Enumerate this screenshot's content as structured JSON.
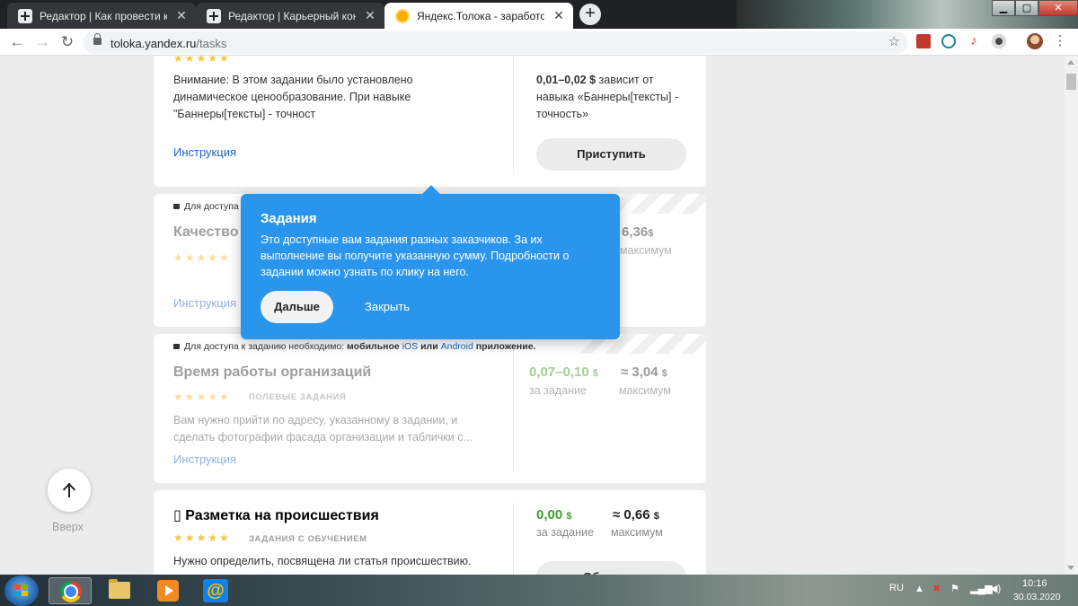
{
  "browser": {
    "tabs": [
      {
        "title": "Редактор | Как провести каранти",
        "close": "✕",
        "active": false
      },
      {
        "title": "Редактор | Карьерный консульт",
        "close": "✕",
        "active": false
      },
      {
        "title": "Яндекс.Толока - заработок в ин",
        "close": "✕",
        "active": true
      }
    ],
    "new_tab": "+",
    "window_controls": {
      "minimize": "▁",
      "maximize": "▢",
      "close": "✕"
    },
    "nav": {
      "back": "←",
      "forward": "→",
      "reload": "↻"
    },
    "url_host": "toloka.yandex.ru",
    "url_path": "/tasks",
    "bookmark_star": "☆"
  },
  "tasks": [
    {
      "stars": "★★★★★",
      "description": "Внимание: В этом задании было установлено динамическое ценообразование. При навыке \"Баннеры[тексты] - точност",
      "instruction": "Инструкция",
      "price_bold": "0,01–0,02 $",
      "price_note": " зависит от навыка «Баннеры[тексты] - точность»",
      "action": "Приступить"
    },
    {
      "access_prefix": "Для доступа",
      "title": "Качество т",
      "stars": "★★★★★",
      "instruction": "Инструкция",
      "max_value": "6,36",
      "currency": "$",
      "max_label": "максимум"
    },
    {
      "access_prefix": "Для доступа к заданию необходимо: ",
      "access_bold1": "мобильное ",
      "access_ios": "iOS",
      "access_or": " или ",
      "access_android": "Android",
      "access_bold2": " приложение.",
      "title": "Время работы организаций",
      "stars": "★★★★★",
      "tag": "ПОЛЕВЫЕ ЗАДАНИЯ",
      "description": "Вам нужно прийти по адресу, указанному в задании, и сделать фотографии фасада организации и таблички с...",
      "instruction": "Инструкция",
      "price": "0,07–0,10",
      "currency": "$",
      "price_label": "за задание",
      "max_value": "≈ 3,04",
      "max_label": "максимум"
    },
    {
      "title": "▯ Разметка на происшествия",
      "stars": "★★★★★",
      "tag": "ЗАДАНИЯ С ОБУЧЕНИЕМ",
      "description": "Нужно определить, посвящена ли статья происшествию.",
      "price": "0,00",
      "currency": "$",
      "price_label": "за задание",
      "max_value": "≈ 0,66",
      "max_label": "максимум",
      "action": "Обучение"
    }
  ],
  "tooltip": {
    "title": "Задания",
    "text": "Это доступные вам задания разных заказчиков. За их выполнение вы получите указанную сумму. Подробности о задании можно узнать по клику на него.",
    "next": "Дальше",
    "close": "Закрыть"
  },
  "up_button": {
    "icon": "arrow-up-icon",
    "label": "Вверх"
  },
  "taskbar": {
    "lang": "RU",
    "time": "10:16",
    "date": "30.03.2020"
  },
  "colors": {
    "tooltip": "#2a95ed",
    "green_price": "#3d9f2d",
    "link": "#1e63c5",
    "star": "#f5c842"
  }
}
